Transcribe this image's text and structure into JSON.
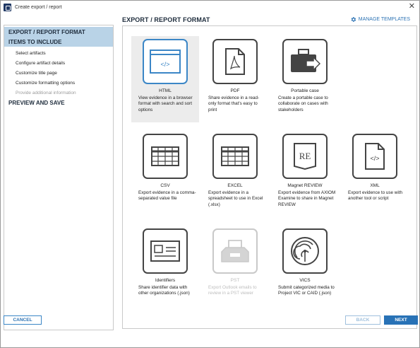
{
  "window": {
    "title": "Create export / report",
    "close_glyph": "✕"
  },
  "sidebar": {
    "sections": [
      {
        "label": "EXPORT / REPORT FORMAT"
      },
      {
        "label": "ITEMS TO INCLUDE"
      }
    ],
    "items": [
      {
        "label": "Select artifacts"
      },
      {
        "label": "Configure artifact details"
      },
      {
        "label": "Customize title page"
      },
      {
        "label": "Customize formatting options"
      },
      {
        "label": "Provide additional information"
      }
    ],
    "last_section": {
      "label": "PREVIEW AND SAVE"
    }
  },
  "main": {
    "title": "EXPORT / REPORT FORMAT",
    "manage_templates": "MANAGE TEMPLATES",
    "accent": "#3b86c6",
    "formats": [
      {
        "name": "HTML",
        "desc": "View evidence in a browser format with search and sort options",
        "icon": "html-browser-icon"
      },
      {
        "name": "PDF",
        "desc": "Share evidence in a read-only format that's easy to print",
        "icon": "pdf-document-icon"
      },
      {
        "name": "Portable case",
        "desc": "Create a portable case to collaborate on cases with stakeholders",
        "icon": "portable-case-icon"
      },
      {
        "name": "CSV",
        "desc": "Export evidence in a comma-separated value file",
        "icon": "csv-table-icon"
      },
      {
        "name": "EXCEL",
        "desc": "Export evidence in a spreadsheet to use in Excel (.xlsx)",
        "icon": "excel-table-icon"
      },
      {
        "name": "Magnet REVIEW",
        "desc": "Export evidence from AXIOM Examine to share in Magnet REVIEW",
        "icon": "magnet-review-icon"
      },
      {
        "name": "XML",
        "desc": "Export evidence to use with another tool or script",
        "icon": "xml-document-icon"
      },
      {
        "name": "Identifiers",
        "desc": "Share identifier data with other organizations (.json)",
        "icon": "identifier-card-icon"
      },
      {
        "name": "PST",
        "desc": "Export Outlook emails to review in a PST viewer",
        "icon": "pst-inbox-icon"
      },
      {
        "name": "VICS",
        "desc": "Submit categorized media to Project VIC or CAID (.json)",
        "icon": "vics-fingerprint-icon"
      }
    ]
  },
  "footer": {
    "cancel": "CANCEL",
    "back": "BACK",
    "next": "NEXT"
  }
}
